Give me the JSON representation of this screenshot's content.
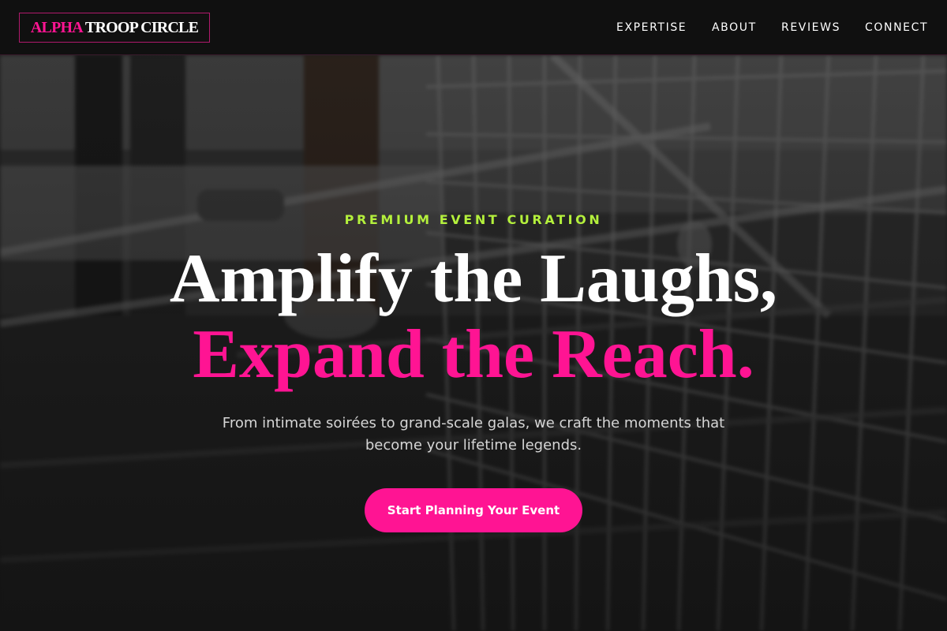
{
  "nav": {
    "logo": {
      "part1": "ALPHA",
      "part2": "TROOP CIRCLE"
    },
    "links": [
      {
        "label": "EXPERTISE"
      },
      {
        "label": "ABOUT"
      },
      {
        "label": "REVIEWS"
      },
      {
        "label": "CONNECT"
      }
    ]
  },
  "hero": {
    "eyebrow": "PREMIUM EVENT CURATION",
    "headline_line1": "Amplify the Laughs,",
    "headline_line2": "Expand the Reach.",
    "subtext": "From intimate soirées to grand-scale galas, we craft the moments that become your lifetime legends.",
    "cta_label": "Start Planning Your Event"
  },
  "colors": {
    "accent_pink": "#ff1493",
    "accent_lime": "#b4f03c",
    "nav_background": "#101010"
  }
}
